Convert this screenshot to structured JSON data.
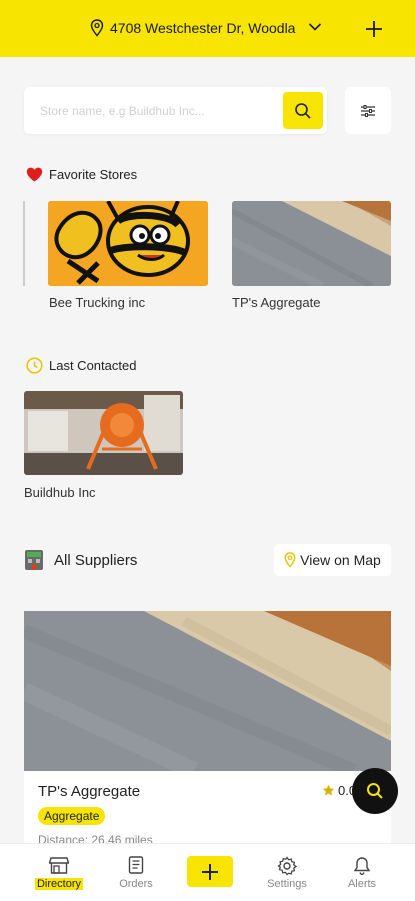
{
  "header": {
    "address": "4708 Westchester Dr, Woodla",
    "icons": [
      "location-pin-icon",
      "chevron-down-icon",
      "plus-icon"
    ]
  },
  "search": {
    "placeholder": "Store name, e.g Buildhub Inc...",
    "value": ""
  },
  "favorites": {
    "title": "Favorite Stores",
    "stores": [
      {
        "name": "Bee Trucking inc"
      },
      {
        "name": "TP's Aggregate"
      }
    ]
  },
  "last_contacted": {
    "title": "Last Contacted",
    "stores": [
      {
        "name": "Buildhub Inc"
      }
    ]
  },
  "all_suppliers": {
    "title": "All Suppliers",
    "view_map_label": "View on Map",
    "suppliers": [
      {
        "name": "TP's Aggregate",
        "category": "Aggregate",
        "rating": "0.0",
        "distance": "Distance: 26.46 miles"
      }
    ]
  },
  "bottom_nav": {
    "items": [
      {
        "label": "Directory"
      },
      {
        "label": "Orders"
      },
      {
        "label": "Settings"
      },
      {
        "label": "Alerts"
      }
    ]
  },
  "colors": {
    "accent": "#f7e400",
    "background": "#f5f5f6",
    "favorite_heart": "#e01e1e",
    "fab": "#111111"
  }
}
